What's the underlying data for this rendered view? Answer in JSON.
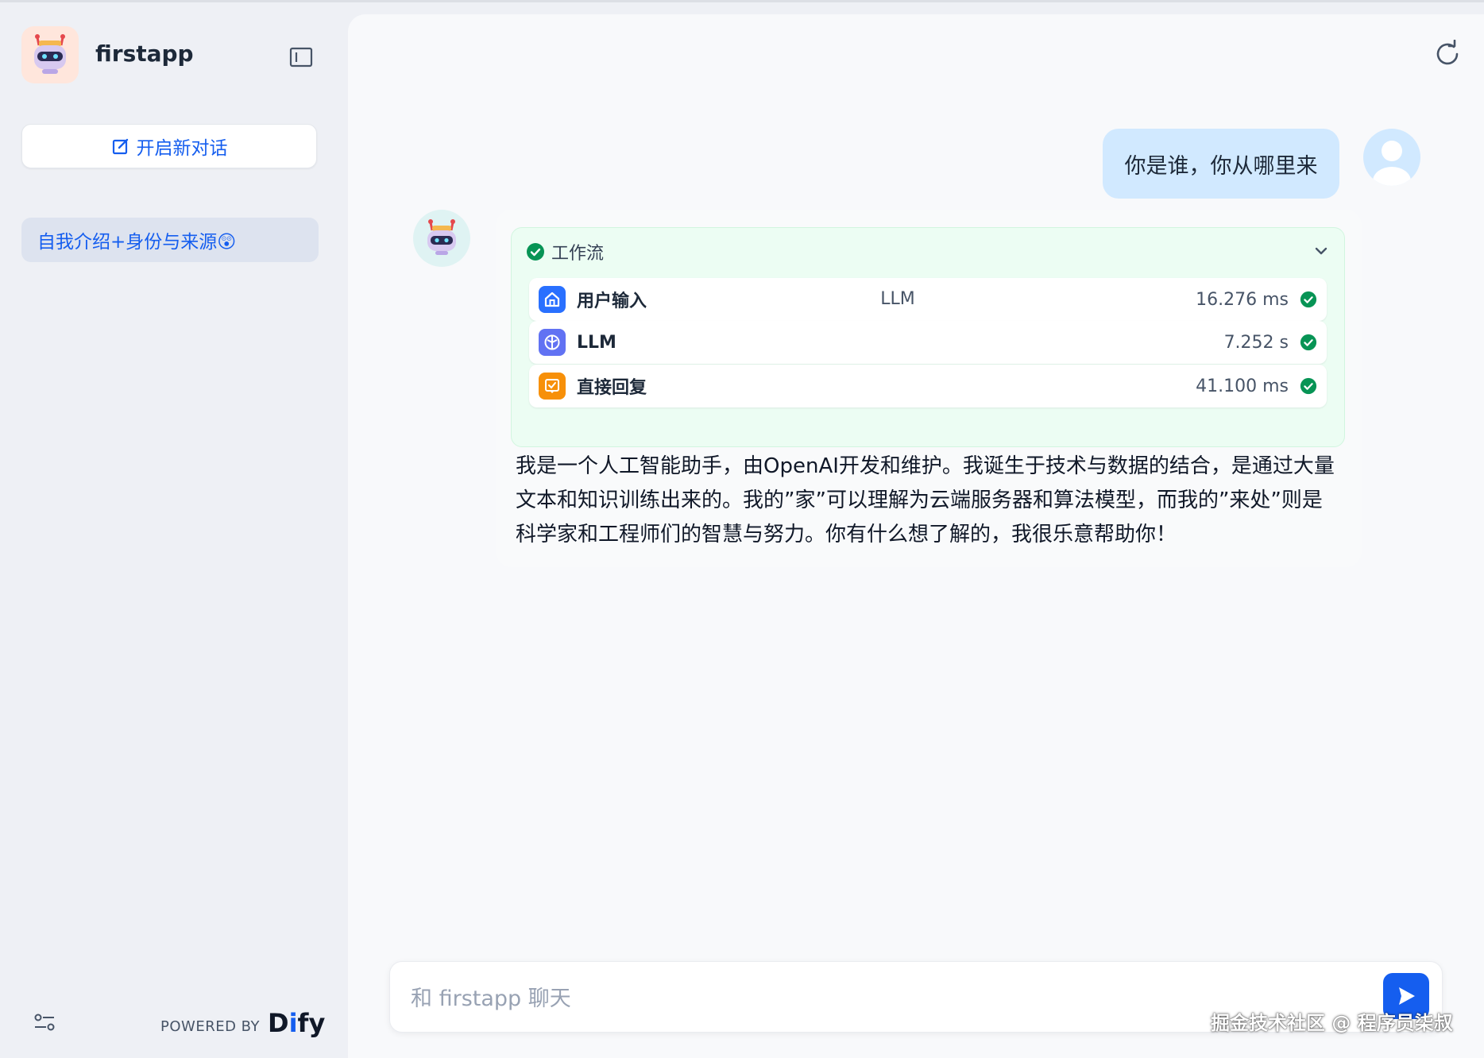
{
  "app": {
    "name": "firstapp"
  },
  "sidebar": {
    "new_chat_label": "开启新对话",
    "conversations": [
      {
        "title": "自我介绍+身份与来源😲"
      }
    ],
    "powered_by_label": "POWERED BY",
    "brand_text": "Dify"
  },
  "chat": {
    "user_message": "你是谁，你从哪里来",
    "workflow": {
      "title": "工作流",
      "status": "succeeded",
      "nodes": [
        {
          "title": "用户输入",
          "time": "16.276 ms",
          "icon": "home-icon"
        },
        {
          "title": "LLM",
          "time": "7.252 s",
          "icon": "llm-icon"
        },
        {
          "title": "直接回复",
          "time": "41.100 ms",
          "icon": "reply-icon"
        }
      ],
      "tooltip": "LLM"
    },
    "answer": "我是一个人工智能助手，由OpenAI开发和维护。我诞生于技术与数据的结合，是通过大量文本和知识训练出来的。我的”家”可以理解为云端服务器和算法模型，而我的”来处”则是科学家和工程师们的智慧与努力。你有什么想了解的，我很乐意帮助你！"
  },
  "input": {
    "placeholder": "和 firstapp 聊天",
    "value": ""
  },
  "watermark": "掘金技术社区 @ 程序员柒叔",
  "colors": {
    "accent": "#155eef",
    "success": "#079455",
    "llm_node": "#6172f3",
    "reply_node": "#f79009",
    "user_bubble": "#d1e9ff"
  }
}
